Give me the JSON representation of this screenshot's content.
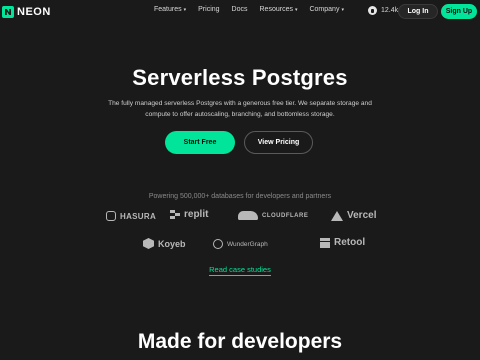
{
  "header": {
    "brand": "NEON",
    "nav": [
      {
        "label": "Features",
        "caret": "▾"
      },
      {
        "label": "Pricing",
        "caret": ""
      },
      {
        "label": "Docs",
        "caret": ""
      },
      {
        "label": "Resources",
        "caret": "▾"
      },
      {
        "label": "Company",
        "caret": "▾"
      }
    ],
    "github_stars": "12.4k",
    "login_label": "Log In",
    "signup_label": "Sign Up"
  },
  "hero": {
    "title": "Serverless Postgres",
    "subtitle": "The fully managed serverless Postgres with a generous free tier. We separate storage and compute to offer autoscaling, branching, and bottomless storage.",
    "primary_cta": "Start Free",
    "secondary_cta": "View Pricing"
  },
  "partners": {
    "heading": "Powering 500,000+ databases for developers and partners",
    "names": [
      "HASURA",
      "replit",
      "CLOUDFLARE",
      "Vercel",
      "Koyeb",
      "WunderGraph",
      "Retool"
    ],
    "case_studies_label": "Read case studies"
  },
  "next_section": {
    "title": "Made for developers"
  },
  "colors": {
    "background": "#1a1a1a",
    "accent": "#00e599"
  }
}
